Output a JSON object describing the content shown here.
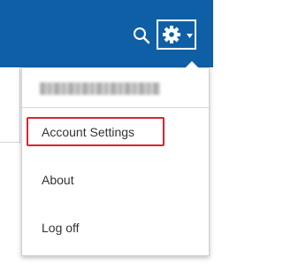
{
  "colors": {
    "topbar": "#0f5fa6",
    "highlight_border": "#d9262e",
    "menu_text": "#333333"
  },
  "header": {
    "search_icon": "search-icon",
    "settings_icon": "gear-icon",
    "settings_caret": "caret-down-icon"
  },
  "dropdown": {
    "items": [
      {
        "label": "Account Settings",
        "highlighted": true
      },
      {
        "label": "About"
      },
      {
        "label": "Log off"
      }
    ]
  }
}
